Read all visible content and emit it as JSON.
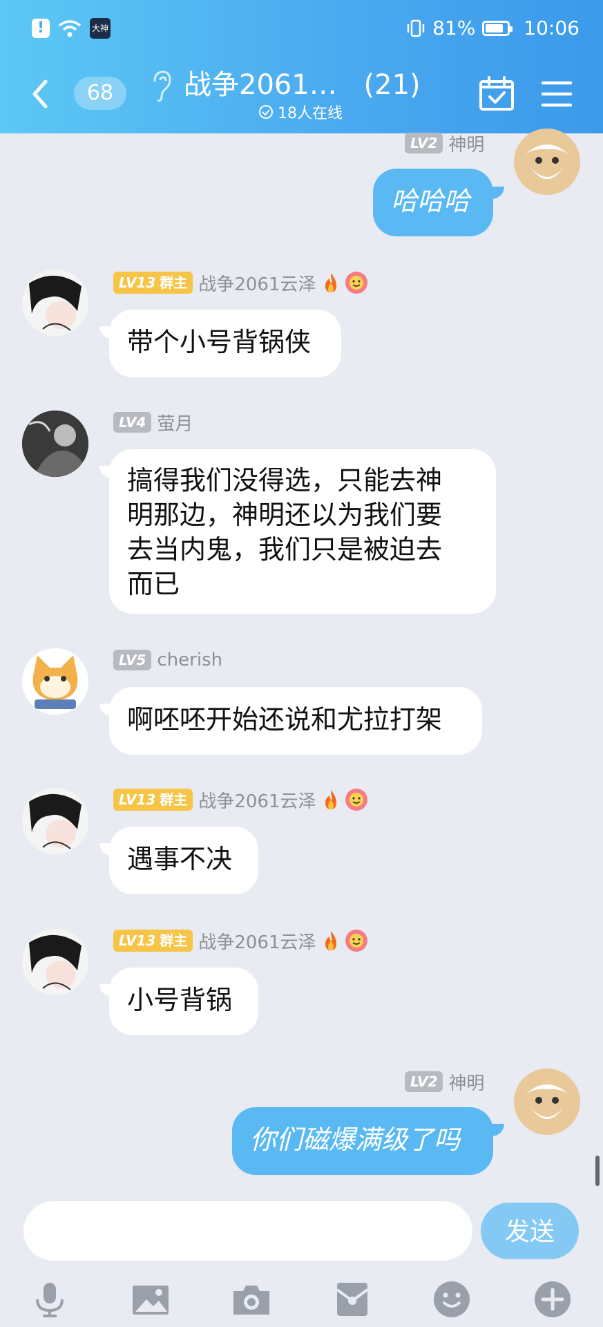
{
  "status_bar": {
    "battery": "81%",
    "time": "10:06",
    "app_icon_text": "大神"
  },
  "header": {
    "unread_count": "68",
    "title": "战争2061…",
    "member_count": "(21)",
    "online_text": "18人在线"
  },
  "messages": [
    {
      "side": "right",
      "level": "LV2",
      "name": "神明",
      "text": "哈哈哈"
    },
    {
      "side": "left",
      "level": "LV13",
      "role": "群主",
      "name": "战争2061云泽",
      "text": "带个小号背锅侠"
    },
    {
      "side": "left",
      "level": "LV4",
      "name": "萤月",
      "lines": [
        "搞得我们没得选，只能去神",
        "明那边，神明还以为我们要",
        "去当内鬼，我们只是被迫去",
        "而已"
      ]
    },
    {
      "side": "left",
      "level": "LV5",
      "name": "cherish",
      "text": "啊呸呸开始还说和尤拉打架"
    },
    {
      "side": "left",
      "level": "LV13",
      "role": "群主",
      "name": "战争2061云泽",
      "text": "遇事不决"
    },
    {
      "side": "left",
      "level": "LV13",
      "role": "群主",
      "name": "战争2061云泽",
      "text": "小号背锅"
    },
    {
      "side": "right",
      "level": "LV2",
      "name": "神明",
      "text": "你们磁爆满级了吗"
    }
  ],
  "composer": {
    "placeholder": "",
    "send_label": "发送"
  },
  "toolbar": [
    "microphone-icon",
    "image-icon",
    "camera-icon",
    "red-packet-icon",
    "emoji-icon",
    "plus-icon"
  ],
  "colors": {
    "header": "#4aa8ef",
    "my_bubble": "#5ab9f3",
    "owner_badge": "#f6c548"
  }
}
